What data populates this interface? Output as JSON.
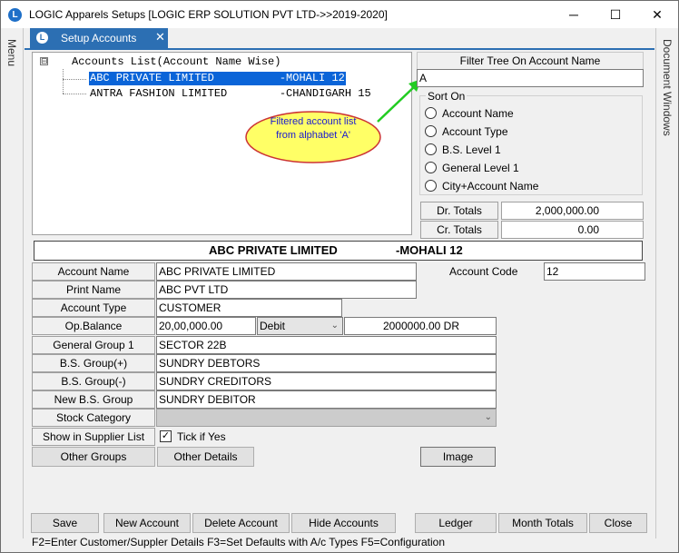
{
  "window": {
    "title": "LOGIC Apparels Setups  [LOGIC ERP SOLUTION PVT LTD->>2019-2020]",
    "minimize": "─",
    "maximize": "☐",
    "close": "✕"
  },
  "left_rail": {
    "label": "Menu"
  },
  "right_rail": {
    "label": "Document Windows"
  },
  "tab": {
    "label": "Setup Accounts",
    "close": "✕"
  },
  "tree": {
    "toggle": "⊟",
    "root_label": "Accounts List(Account Name Wise)",
    "items": [
      {
        "label": "ABC PRIVATE LIMITED          -MOHALI 12",
        "selected": true
      },
      {
        "label": "ANTRA FASHION LIMITED        -CHANDIGARH 15",
        "selected": false
      }
    ]
  },
  "callout": {
    "text": "Filtered  account  list from  alphabet  'A'",
    "color": "#ffff66",
    "arrow_color": "#22cc22"
  },
  "filter": {
    "header": "Filter Tree On Account Name",
    "value": "A"
  },
  "sort": {
    "legend": "Sort On",
    "options": [
      "Account Name",
      "Account Type",
      "B.S. Level 1",
      "General Level 1",
      "City+Account Name"
    ]
  },
  "totals": {
    "dr_label": "Dr. Totals",
    "dr_value": "2,000,000.00",
    "cr_label": "Cr. Totals",
    "cr_value": "0.00"
  },
  "banner": {
    "name": "ABC PRIVATE LIMITED",
    "location": "-MOHALI 12"
  },
  "form": {
    "account_name_label": "Account Name",
    "account_name": "ABC PRIVATE LIMITED",
    "account_code_label": "Account Code",
    "account_code": "12",
    "print_name_label": "Print Name",
    "print_name": "ABC PVT LTD",
    "account_type_label": "Account Type",
    "account_type": "CUSTOMER",
    "op_balance_label": "Op.Balance",
    "op_balance": "20,00,000.00",
    "op_balance_type": "Debit",
    "op_balance_display": "2000000.00 DR",
    "general_group_label": "General Group 1",
    "general_group": "SECTOR 22B",
    "bs_group_plus_label": "B.S. Group(+)",
    "bs_group_plus": "SUNDRY DEBTORS",
    "bs_group_minus_label": "B.S. Group(-)",
    "bs_group_minus": "SUNDRY CREDITORS",
    "new_bs_group_label": "New B.S. Group",
    "new_bs_group": "SUNDRY DEBITOR",
    "stock_category_label": "Stock Category",
    "stock_category": "",
    "show_supplier_label": "Show in Supplier List",
    "tick_label": "Tick if Yes",
    "tick_checked": true
  },
  "buttons": {
    "other_groups": "Other Groups",
    "other_details": "Other Details",
    "image": "Image",
    "save": "Save",
    "new_account": "New Account",
    "delete_account": "Delete Account",
    "hide_accounts": "Hide Accounts",
    "ledger": "Ledger",
    "month_totals": "Month Totals",
    "close": "Close"
  },
  "status": {
    "text": "F2=Enter Customer/Suppler Details  F3=Set Defaults with A/c Types  F5=Configuration"
  }
}
